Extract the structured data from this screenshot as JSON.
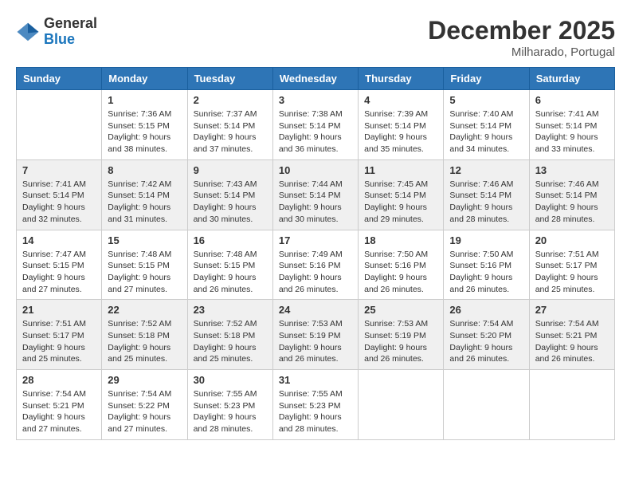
{
  "header": {
    "logo": {
      "general": "General",
      "blue": "Blue"
    },
    "title": "December 2025",
    "location": "Milharado, Portugal"
  },
  "calendar": {
    "days_of_week": [
      "Sunday",
      "Monday",
      "Tuesday",
      "Wednesday",
      "Thursday",
      "Friday",
      "Saturday"
    ],
    "weeks": [
      [
        {
          "day": "",
          "info": ""
        },
        {
          "day": "1",
          "info": "Sunrise: 7:36 AM\nSunset: 5:15 PM\nDaylight: 9 hours\nand 38 minutes."
        },
        {
          "day": "2",
          "info": "Sunrise: 7:37 AM\nSunset: 5:14 PM\nDaylight: 9 hours\nand 37 minutes."
        },
        {
          "day": "3",
          "info": "Sunrise: 7:38 AM\nSunset: 5:14 PM\nDaylight: 9 hours\nand 36 minutes."
        },
        {
          "day": "4",
          "info": "Sunrise: 7:39 AM\nSunset: 5:14 PM\nDaylight: 9 hours\nand 35 minutes."
        },
        {
          "day": "5",
          "info": "Sunrise: 7:40 AM\nSunset: 5:14 PM\nDaylight: 9 hours\nand 34 minutes."
        },
        {
          "day": "6",
          "info": "Sunrise: 7:41 AM\nSunset: 5:14 PM\nDaylight: 9 hours\nand 33 minutes."
        }
      ],
      [
        {
          "day": "7",
          "info": "Sunrise: 7:41 AM\nSunset: 5:14 PM\nDaylight: 9 hours\nand 32 minutes."
        },
        {
          "day": "8",
          "info": "Sunrise: 7:42 AM\nSunset: 5:14 PM\nDaylight: 9 hours\nand 31 minutes."
        },
        {
          "day": "9",
          "info": "Sunrise: 7:43 AM\nSunset: 5:14 PM\nDaylight: 9 hours\nand 30 minutes."
        },
        {
          "day": "10",
          "info": "Sunrise: 7:44 AM\nSunset: 5:14 PM\nDaylight: 9 hours\nand 30 minutes."
        },
        {
          "day": "11",
          "info": "Sunrise: 7:45 AM\nSunset: 5:14 PM\nDaylight: 9 hours\nand 29 minutes."
        },
        {
          "day": "12",
          "info": "Sunrise: 7:46 AM\nSunset: 5:14 PM\nDaylight: 9 hours\nand 28 minutes."
        },
        {
          "day": "13",
          "info": "Sunrise: 7:46 AM\nSunset: 5:14 PM\nDaylight: 9 hours\nand 28 minutes."
        }
      ],
      [
        {
          "day": "14",
          "info": "Sunrise: 7:47 AM\nSunset: 5:15 PM\nDaylight: 9 hours\nand 27 minutes."
        },
        {
          "day": "15",
          "info": "Sunrise: 7:48 AM\nSunset: 5:15 PM\nDaylight: 9 hours\nand 27 minutes."
        },
        {
          "day": "16",
          "info": "Sunrise: 7:48 AM\nSunset: 5:15 PM\nDaylight: 9 hours\nand 26 minutes."
        },
        {
          "day": "17",
          "info": "Sunrise: 7:49 AM\nSunset: 5:16 PM\nDaylight: 9 hours\nand 26 minutes."
        },
        {
          "day": "18",
          "info": "Sunrise: 7:50 AM\nSunset: 5:16 PM\nDaylight: 9 hours\nand 26 minutes."
        },
        {
          "day": "19",
          "info": "Sunrise: 7:50 AM\nSunset: 5:16 PM\nDaylight: 9 hours\nand 26 minutes."
        },
        {
          "day": "20",
          "info": "Sunrise: 7:51 AM\nSunset: 5:17 PM\nDaylight: 9 hours\nand 25 minutes."
        }
      ],
      [
        {
          "day": "21",
          "info": "Sunrise: 7:51 AM\nSunset: 5:17 PM\nDaylight: 9 hours\nand 25 minutes."
        },
        {
          "day": "22",
          "info": "Sunrise: 7:52 AM\nSunset: 5:18 PM\nDaylight: 9 hours\nand 25 minutes."
        },
        {
          "day": "23",
          "info": "Sunrise: 7:52 AM\nSunset: 5:18 PM\nDaylight: 9 hours\nand 25 minutes."
        },
        {
          "day": "24",
          "info": "Sunrise: 7:53 AM\nSunset: 5:19 PM\nDaylight: 9 hours\nand 26 minutes."
        },
        {
          "day": "25",
          "info": "Sunrise: 7:53 AM\nSunset: 5:19 PM\nDaylight: 9 hours\nand 26 minutes."
        },
        {
          "day": "26",
          "info": "Sunrise: 7:54 AM\nSunset: 5:20 PM\nDaylight: 9 hours\nand 26 minutes."
        },
        {
          "day": "27",
          "info": "Sunrise: 7:54 AM\nSunset: 5:21 PM\nDaylight: 9 hours\nand 26 minutes."
        }
      ],
      [
        {
          "day": "28",
          "info": "Sunrise: 7:54 AM\nSunset: 5:21 PM\nDaylight: 9 hours\nand 27 minutes."
        },
        {
          "day": "29",
          "info": "Sunrise: 7:54 AM\nSunset: 5:22 PM\nDaylight: 9 hours\nand 27 minutes."
        },
        {
          "day": "30",
          "info": "Sunrise: 7:55 AM\nSunset: 5:23 PM\nDaylight: 9 hours\nand 28 minutes."
        },
        {
          "day": "31",
          "info": "Sunrise: 7:55 AM\nSunset: 5:23 PM\nDaylight: 9 hours\nand 28 minutes."
        },
        {
          "day": "",
          "info": ""
        },
        {
          "day": "",
          "info": ""
        },
        {
          "day": "",
          "info": ""
        }
      ]
    ]
  }
}
